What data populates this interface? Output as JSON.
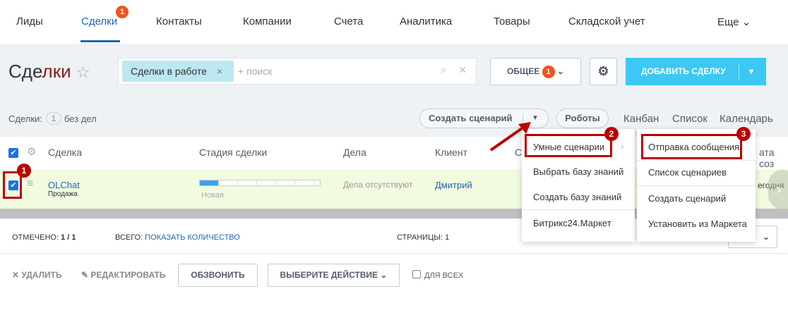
{
  "nav": {
    "items": [
      "Лиды",
      "Сделки",
      "Контакты",
      "Компании",
      "Счета",
      "Аналитика",
      "Товары",
      "Складской учет"
    ],
    "more": "Еще",
    "deals_badge": "1"
  },
  "header": {
    "title_part1": "Сде",
    "title_part2": "лки",
    "filter_chip": "Сделки в работе",
    "search_placeholder": "+ поиск",
    "general_button": "ОБЩЕЕ",
    "general_badge": "1",
    "add_button": "ДОБАВИТЬ СДЕЛКУ"
  },
  "toolbar": {
    "deals_label": "Сделки:",
    "deals_count": "1",
    "no_tasks": "без дел",
    "create_scenario": "Создать сценарий",
    "robots": "Роботы",
    "views": [
      "Канбан",
      "Список",
      "Календарь"
    ]
  },
  "table": {
    "columns": [
      "Сделка",
      "Стадия сделки",
      "Дела",
      "Клиент",
      "С",
      "ата соз"
    ],
    "row": {
      "name": "OLChat",
      "type": "Продажа",
      "stage": "Новая",
      "stage_progress": 0.15,
      "tasks": "Дела отсутствуют",
      "client": "Дмитрий",
      "date": "егодня"
    }
  },
  "footer": {
    "selected_label": "ОТМЕЧЕНО:",
    "selected_value": "1 / 1",
    "total_label": "ВСЕГО:",
    "total_link": "ПОКАЗАТЬ КОЛИЧЕСТВО",
    "pages_label": "СТРАНИЦЫ:",
    "pages_value": "1"
  },
  "actions": {
    "delete": "УДАЛИТЬ",
    "edit": "РЕДАКТИРОВАТЬ",
    "call": "ОБЗВОНИТЬ",
    "choose": "ВЫБЕРИТЕ ДЕЙСТВИЕ",
    "for_all": "ДЛЯ ВСЕХ"
  },
  "menu1": [
    "Умные сценарии",
    "Выбрать базу знаний",
    "Создать базу знаний",
    "Битрикс24.Маркет"
  ],
  "menu2": [
    "Отправка сообщения",
    "Список сценариев",
    "Создать сценарий",
    "Установить из Маркета"
  ],
  "annotations": [
    "1",
    "2",
    "3"
  ],
  "colors": {
    "accent": "#2067b0",
    "add": "#3bc8f5",
    "annotation": "#b00000"
  }
}
